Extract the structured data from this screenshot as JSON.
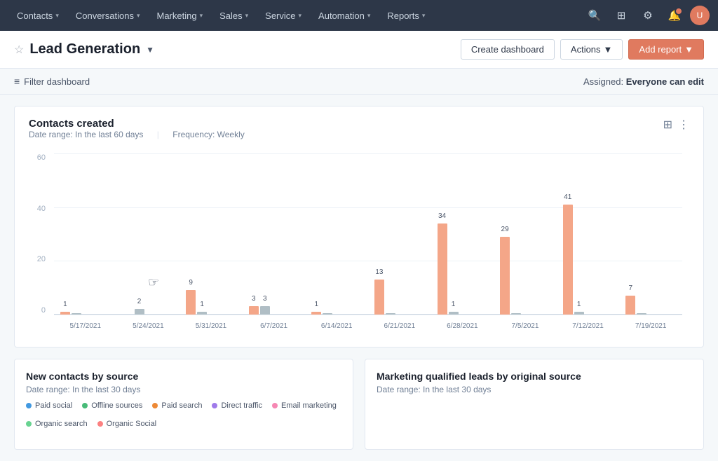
{
  "navbar": {
    "items": [
      {
        "label": "Contacts",
        "id": "contacts"
      },
      {
        "label": "Conversations",
        "id": "conversations"
      },
      {
        "label": "Marketing",
        "id": "marketing"
      },
      {
        "label": "Sales",
        "id": "sales"
      },
      {
        "label": "Service",
        "id": "service"
      },
      {
        "label": "Automation",
        "id": "automation"
      },
      {
        "label": "Reports",
        "id": "reports"
      }
    ],
    "icons": {
      "search": "🔍",
      "grid": "⊞",
      "settings": "⚙",
      "notifications": "🔔",
      "avatar": "U"
    }
  },
  "page": {
    "star_icon": "☆",
    "title": "Lead Generation",
    "dropdown_label": "▼"
  },
  "header_actions": {
    "create_dashboard": "Create dashboard",
    "actions": "Actions",
    "add_report": "Add report"
  },
  "filter_bar": {
    "filter_icon": "≡",
    "filter_label": "Filter dashboard",
    "assigned_prefix": "Assigned:",
    "assigned_value": "Everyone can edit"
  },
  "chart": {
    "title": "Contacts created",
    "date_range_label": "Date range:",
    "date_range_value": "In the last 60 days",
    "frequency_label": "Frequency:",
    "frequency_value": "Weekly",
    "y_labels": [
      "60",
      "40",
      "20",
      "0"
    ],
    "bars": [
      {
        "date": "5/17/2021",
        "primary": 1,
        "secondary": 0
      },
      {
        "date": "5/24/2021",
        "primary": 0,
        "secondary": 2
      },
      {
        "date": "5/31/2021",
        "primary": 9,
        "secondary": 1
      },
      {
        "date": "6/7/2021",
        "primary": 3,
        "secondary": 3
      },
      {
        "date": "6/14/2021",
        "primary": 1,
        "secondary": 0
      },
      {
        "date": "6/21/2021",
        "primary": 13,
        "secondary": 0
      },
      {
        "date": "6/28/2021",
        "primary": 34,
        "secondary": 1
      },
      {
        "date": "7/5/2021",
        "primary": 29,
        "secondary": 0
      },
      {
        "date": "7/12/2021",
        "primary": 41,
        "secondary": 1
      },
      {
        "date": "7/19/2021",
        "primary": 7,
        "secondary": 0
      }
    ],
    "y_max": 60,
    "filter_icon": "⊞",
    "more_icon": "⋮"
  },
  "bottom_cards": {
    "left": {
      "title": "New contacts by source",
      "date_range": "Date range: In the last 30 days",
      "legend": [
        {
          "label": "Paid social",
          "color": "#4299e1"
        },
        {
          "label": "Offline sources",
          "color": "#48bb78"
        },
        {
          "label": "Paid search",
          "color": "#ed8936"
        },
        {
          "label": "Direct traffic",
          "color": "#9f7aea"
        },
        {
          "label": "Email marketing",
          "color": "#f687b3"
        },
        {
          "label": "Organic search",
          "color": "#68d391"
        },
        {
          "label": "Organic Social",
          "color": "#fc8181"
        }
      ]
    },
    "right": {
      "title": "Marketing qualified leads by original source",
      "date_range": "Date range: In the last 30 days"
    }
  }
}
